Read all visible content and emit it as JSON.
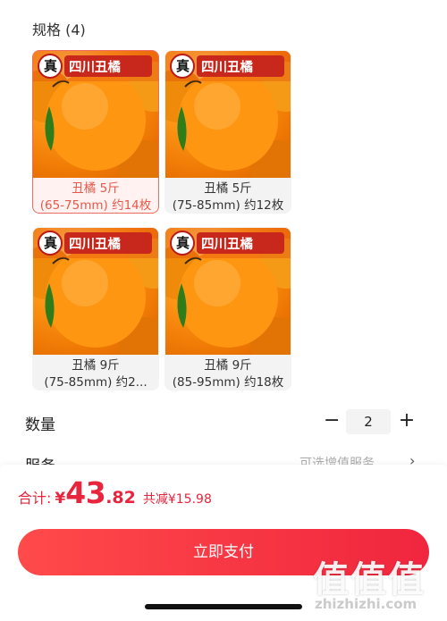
{
  "spec": {
    "title": "规格 (4)",
    "items": [
      {
        "brand": "四川丑橘",
        "badge": "真",
        "line1": "丑橘 5斤",
        "line2": "(65-75mm) 约14枚",
        "selected": true
      },
      {
        "brand": "四川丑橘",
        "badge": "真",
        "line1": "丑橘 5斤",
        "line2": "(75-85mm) 约12枚",
        "selected": false
      },
      {
        "brand": "四川丑橘",
        "badge": "真",
        "line1": "丑橘 9斤",
        "line2": "(75-85mm) 约2...",
        "selected": false
      },
      {
        "brand": "四川丑橘",
        "badge": "真",
        "line1": "丑橘 9斤",
        "line2": "(85-95mm) 约18枚",
        "selected": false
      }
    ]
  },
  "quantity": {
    "label": "数量",
    "minus": "−",
    "value": "2",
    "plus": "+"
  },
  "service": {
    "label": "服务",
    "value": "可选增值服务",
    "arrow": "›"
  },
  "summary": {
    "total_label": "合计:",
    "currency": "¥",
    "amount_int": "43",
    "amount_dec": ".82",
    "discount": "共减¥15.98"
  },
  "pay_button": "立即支付",
  "watermark": {
    "big": "值值值",
    "small": "zhizhizhi.com"
  },
  "colors": {
    "accent": "#e8253c",
    "selected_border": "#ef6a5f"
  }
}
